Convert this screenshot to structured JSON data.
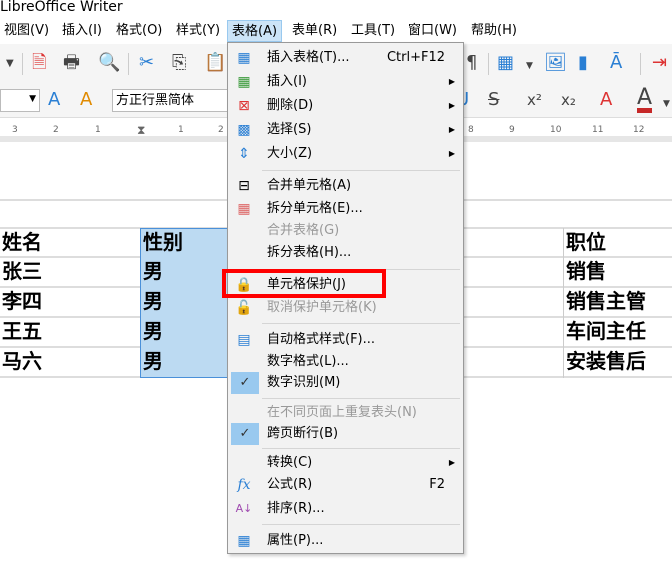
{
  "title": "LibreOffice Writer",
  "menubar": [
    "视图(V)",
    "插入(I)",
    "格式(O)",
    "样式(Y)",
    "表格(A)",
    "表单(R)",
    "工具(T)",
    "窗口(W)",
    "帮助(H)"
  ],
  "font_name": "方正行黑简体",
  "ruler": [
    "3",
    "2",
    "1",
    "1",
    "2",
    "8",
    "9",
    "10",
    "11",
    "12"
  ],
  "table": {
    "col1": [
      "姓名",
      "张三",
      "李四",
      "王五",
      "马六"
    ],
    "col2": [
      "性别",
      "男",
      "男",
      "男",
      "男"
    ],
    "col_last": [
      "职位",
      "销售",
      "销售主管",
      "车间主任",
      "安装售后"
    ]
  },
  "menu": {
    "items": [
      {
        "label": "插入表格(T)...",
        "shortcut": "Ctrl+F12"
      },
      {
        "label": "插入(I)"
      },
      {
        "label": "删除(D)"
      },
      {
        "label": "选择(S)"
      },
      {
        "label": "大小(Z)"
      },
      {
        "label": "合并单元格(A)"
      },
      {
        "label": "拆分单元格(E)..."
      },
      {
        "label": "合并表格(G)"
      },
      {
        "label": "拆分表格(H)..."
      },
      {
        "label": "单元格保护(J)"
      },
      {
        "label": "取消保护单元格(K)"
      },
      {
        "label": "自动格式样式(F)..."
      },
      {
        "label": "数字格式(L)..."
      },
      {
        "label": "数字识别(M)"
      },
      {
        "label": "在不同页面上重复表头(N)"
      },
      {
        "label": "跨页断行(B)"
      },
      {
        "label": "转换(C)"
      },
      {
        "label": "公式(R)",
        "shortcut": "F2"
      },
      {
        "label": "排序(R)..."
      },
      {
        "label": "属性(P)..."
      }
    ]
  },
  "colors": {
    "highlight": "#ff0000",
    "selection": "#bcdaf2",
    "check": "#99c9ef"
  }
}
